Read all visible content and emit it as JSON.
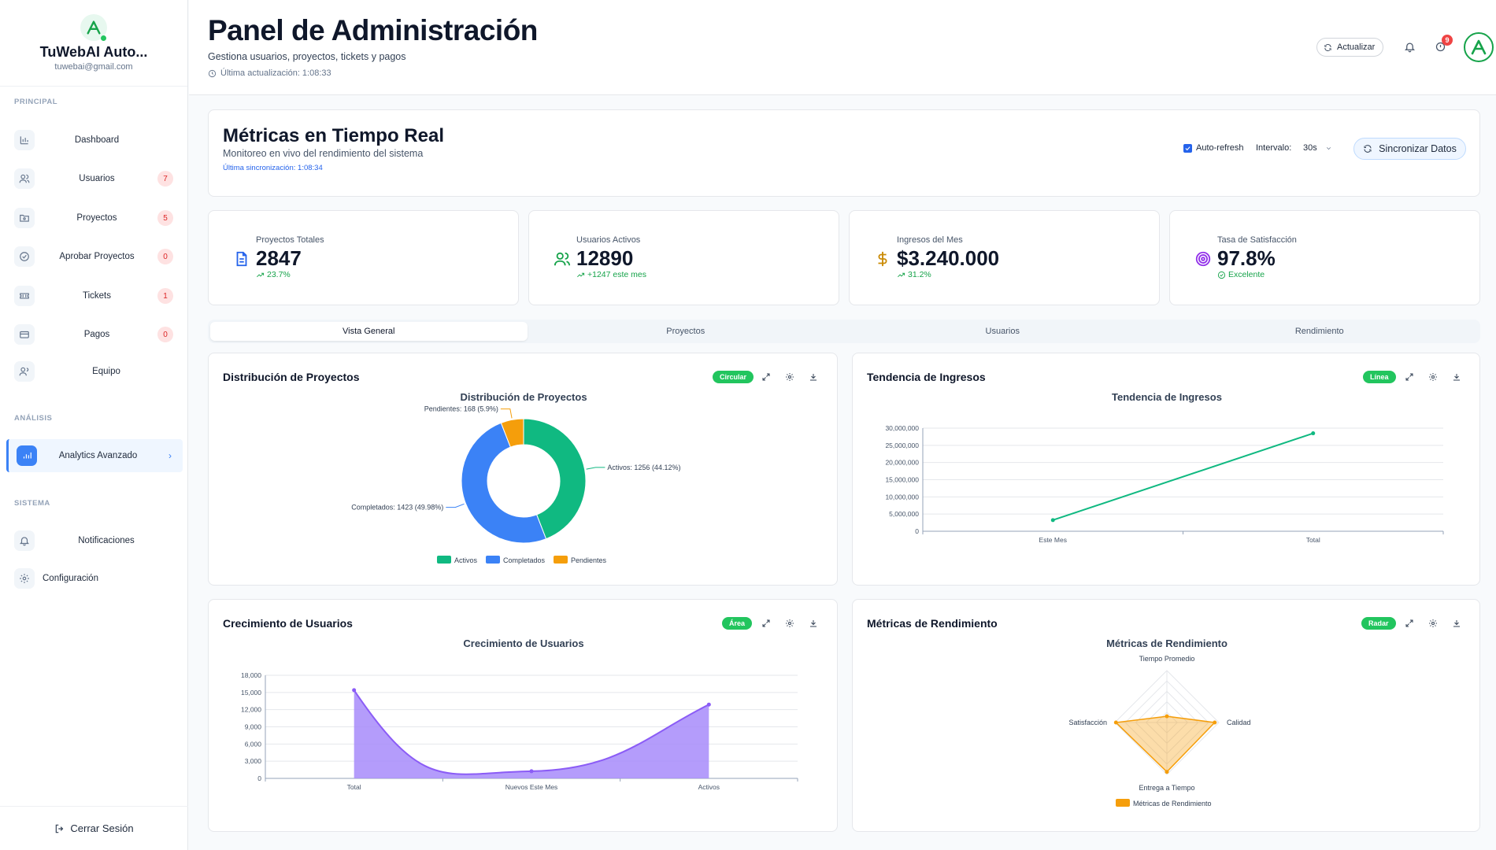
{
  "brand": {
    "name": "TuWebAI Auto...",
    "email": "tuwebai@gmail.com"
  },
  "sidebar": {
    "sections": [
      "PRINCIPAL",
      "ANÁLISIS",
      "SISTEMA"
    ],
    "items": [
      {
        "label": "Dashboard",
        "icon": "bar-chart-icon"
      },
      {
        "label": "Usuarios",
        "icon": "users-icon",
        "badge": "7"
      },
      {
        "label": "Proyectos",
        "icon": "folder-icon",
        "badge": "5"
      },
      {
        "label": "Aprobar Proyectos",
        "icon": "check-circle-icon",
        "badge": "0"
      },
      {
        "label": "Tickets",
        "icon": "ticket-icon",
        "badge": "1"
      },
      {
        "label": "Pagos",
        "icon": "credit-card-icon",
        "badge": "0"
      },
      {
        "label": "Equipo",
        "icon": "team-icon"
      },
      {
        "label": "Analytics Avanzado",
        "icon": "analytics-icon",
        "active": true
      },
      {
        "label": "Notificaciones",
        "icon": "bell-icon"
      },
      {
        "label": "Configuración",
        "icon": "gear-icon"
      }
    ],
    "logout": "Cerrar Sesión"
  },
  "header": {
    "title": "Panel de Administración",
    "subtitle": "Gestiona usuarios, proyectos, tickets y pagos",
    "updated": "Última actualización: 1:08:33",
    "refresh": "Actualizar",
    "notif_badge": "9"
  },
  "realtime": {
    "title": "Métricas en Tiempo Real",
    "subtitle": "Monitoreo en vivo del rendimiento del sistema",
    "sync": "Última sincronización: 1:08:34",
    "auto_refresh": "Auto-refresh",
    "interval_label": "Intervalo:",
    "interval_value": "30s",
    "sync_button": "Sincronizar Datos"
  },
  "stats": [
    {
      "label": "Proyectos Totales",
      "value": "2847",
      "trend": "23.7%",
      "icon": "document-icon",
      "color": "#2563eb"
    },
    {
      "label": "Usuarios Activos",
      "value": "12890",
      "trend": "+1247 este mes",
      "icon": "users-icon",
      "color": "#16a34a"
    },
    {
      "label": "Ingresos del Mes",
      "value": "$3.240.000",
      "trend": "31.2%",
      "icon": "dollar-icon",
      "color": "#ca8a04"
    },
    {
      "label": "Tasa de Satisfacción",
      "value": "97.8%",
      "trend": "Excelente",
      "icon": "target-icon",
      "color": "#9333ea"
    }
  ],
  "tabs": [
    "Vista General",
    "Proyectos",
    "Usuarios",
    "Rendimiento"
  ],
  "cards": [
    {
      "title": "Distribución de Proyectos",
      "pill": "Circular"
    },
    {
      "title": "Tendencia de Ingresos",
      "pill": "Línea"
    },
    {
      "title": "Crecimiento de Usuarios",
      "pill": "Área"
    },
    {
      "title": "Métricas de Rendimiento",
      "pill": "Radar"
    }
  ],
  "colors": {
    "green": "#10b981",
    "blue": "#3b82f6",
    "orange": "#f59e0b",
    "purple": "#8b5cf6",
    "purple_fill": "#a78bfa"
  },
  "chart_data": [
    {
      "type": "pie",
      "title": "Distribución de Proyectos",
      "categories": [
        "Activos",
        "Completados",
        "Pendientes"
      ],
      "values": [
        1256,
        1423,
        168
      ],
      "slice_labels": [
        "Activos: 1256 (44.12%)",
        "Completados: 1423 (49.98%)",
        "Pendientes: 168 (5.9%)"
      ],
      "legend": "bottom"
    },
    {
      "type": "line",
      "title": "Tendencia de Ingresos",
      "categories": [
        "Este Mes",
        "Total"
      ],
      "values": [
        3240000,
        28500000
      ],
      "ylim": [
        0,
        30000000
      ],
      "yticks": [
        "0",
        "5,000,000",
        "10,000,000",
        "15,000,000",
        "20,000,000",
        "25,000,000",
        "30,000,000"
      ],
      "grid": true
    },
    {
      "type": "area",
      "title": "Crecimiento de Usuarios",
      "categories": [
        "Total",
        "Nuevos Este Mes",
        "Activos"
      ],
      "values": [
        15400,
        1247,
        12890
      ],
      "ylim": [
        0,
        18000
      ],
      "yticks": [
        "0",
        "3,000",
        "6,000",
        "9,000",
        "12,000",
        "15,000",
        "18,000"
      ],
      "grid": true
    },
    {
      "type": "radar",
      "title": "Métricas de Rendimiento",
      "categories": [
        "Tiempo Promedio",
        "Calidad",
        "Entrega a Tiempo",
        "Satisfacción"
      ],
      "values": [
        12,
        92,
        95,
        98
      ],
      "rmax": 100,
      "series": [
        {
          "name": "Métricas de Rendimiento"
        }
      ],
      "legend": "bottom"
    }
  ]
}
